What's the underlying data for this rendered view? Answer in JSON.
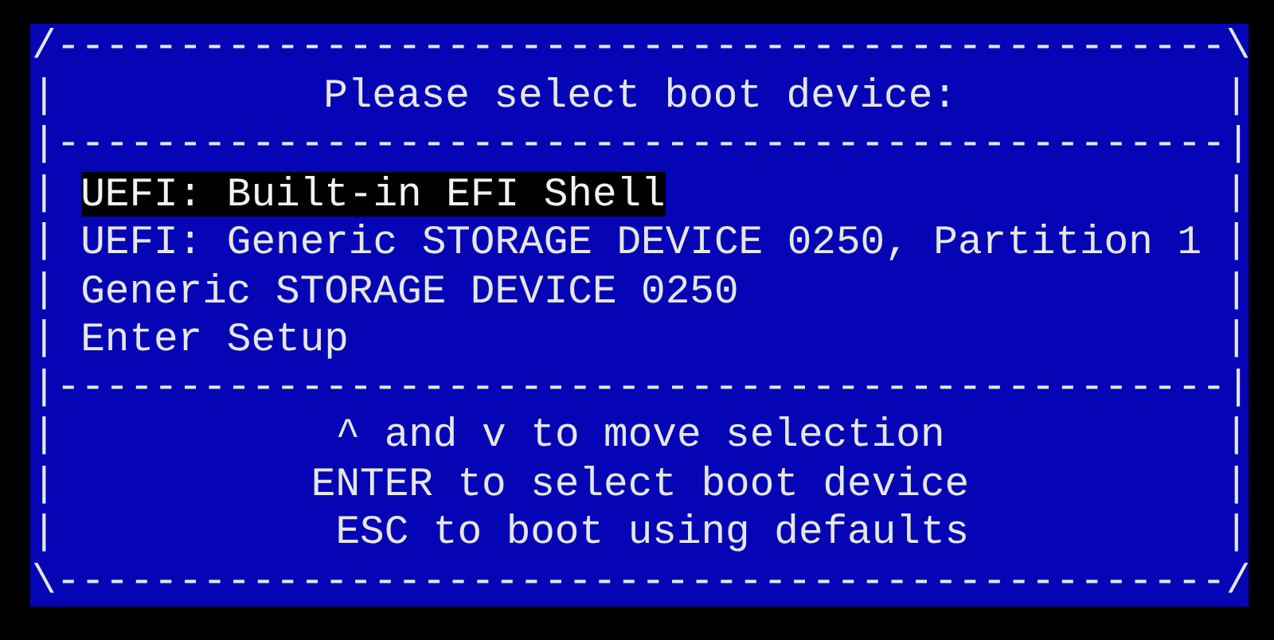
{
  "lines": [
    {
      "kind": "border",
      "text": "/------------------------------------------------\\"
    },
    {
      "kind": "title",
      "left": "|",
      "text": "Please select boot device:",
      "right": "|"
    },
    {
      "kind": "border",
      "text": "|------------------------------------------------|"
    },
    {
      "kind": "option",
      "left": "|",
      "text": "UEFI: Built-in EFI Shell",
      "right": "|",
      "selected": true
    },
    {
      "kind": "option",
      "left": "|",
      "text": "UEFI: Generic STORAGE DEVICE 0250, Partition 1",
      "right": "|",
      "selected": false
    },
    {
      "kind": "option",
      "left": "|",
      "text": "Generic STORAGE DEVICE 0250",
      "right": "|",
      "selected": false
    },
    {
      "kind": "option",
      "left": "|",
      "text": "Enter Setup",
      "right": "|",
      "selected": false
    },
    {
      "kind": "border",
      "text": "|------------------------------------------------|"
    },
    {
      "kind": "help",
      "left": "|",
      "text": "^ and v to move selection",
      "right": "|"
    },
    {
      "kind": "help",
      "left": "|",
      "text": "ENTER to select boot device",
      "right": "|"
    },
    {
      "kind": "help",
      "left": "|",
      "text": " ESC to boot using defaults",
      "right": "|"
    },
    {
      "kind": "border",
      "text": "\\------------------------------------------------/"
    }
  ]
}
